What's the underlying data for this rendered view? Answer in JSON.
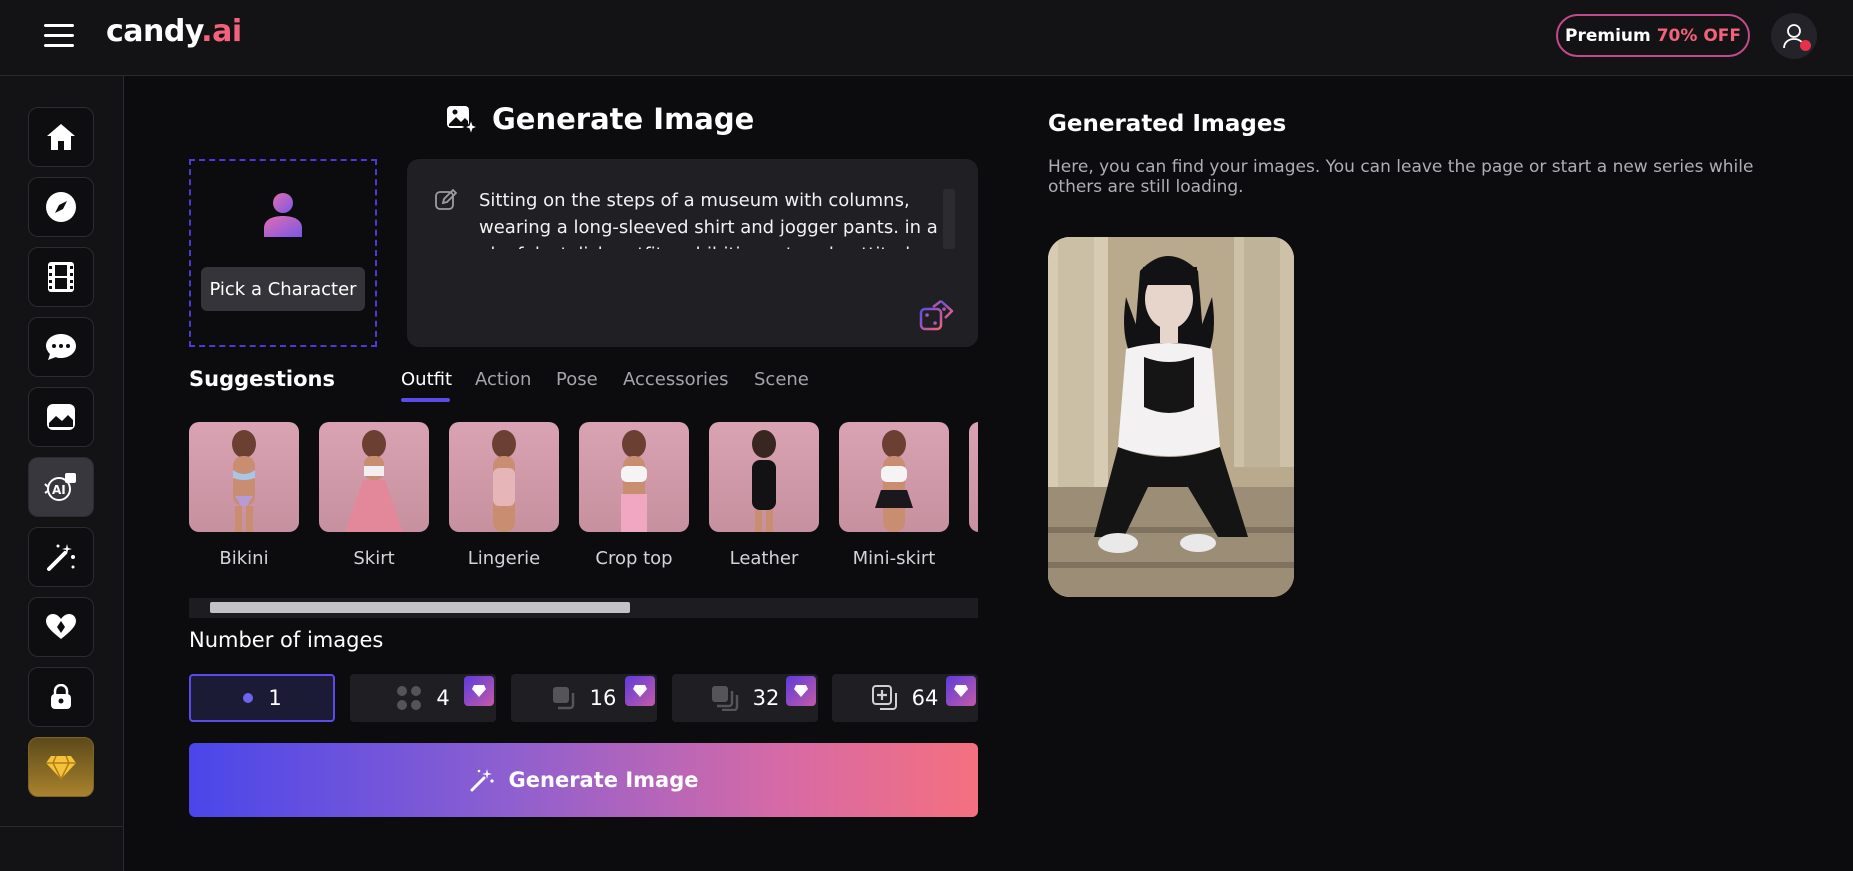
{
  "header": {
    "logo_main": "candy",
    "logo_suffix": ".ai",
    "premium_label": "Premium",
    "premium_discount": "70% OFF"
  },
  "sidebar": {
    "items": [
      {
        "icon": "home-icon"
      },
      {
        "icon": "compass-icon"
      },
      {
        "icon": "film-icon"
      },
      {
        "icon": "chat-icon"
      },
      {
        "icon": "gallery-icon"
      },
      {
        "icon": "ai-image-icon",
        "active": true
      },
      {
        "icon": "magic-wand-icon"
      },
      {
        "icon": "heart-hands-icon"
      },
      {
        "icon": "lock-icon"
      },
      {
        "icon": "diamond-icon",
        "premium": true
      }
    ]
  },
  "generator": {
    "title": "Generate Image",
    "pick_character": "Pick a Character",
    "prompt": "Sitting on the steps of a museum with columns, wearing a long-sleeved shirt and jogger pants. in a playful, stylish outfit, exhibiting a trendy attitude."
  },
  "suggestions": {
    "title": "Suggestions",
    "tabs": [
      "Outfit",
      "Action",
      "Pose",
      "Accessories",
      "Scene"
    ],
    "active_tab": "Outfit",
    "items": [
      "Bikini",
      "Skirt",
      "Lingerie",
      "Crop top",
      "Leather",
      "Mini-skirt"
    ]
  },
  "number_of_images": {
    "title": "Number of images",
    "options": [
      "1",
      "4",
      "16",
      "32",
      "64"
    ],
    "selected": "1"
  },
  "generate_button": "Generate Image",
  "results": {
    "title": "Generated Images",
    "description": "Here, you can find your images. You can leave the page or start a new series while others are still loading."
  },
  "colors": {
    "accent": "#5a4ce8",
    "brand_pink": "#f2637b",
    "background": "#0c0b0e"
  }
}
